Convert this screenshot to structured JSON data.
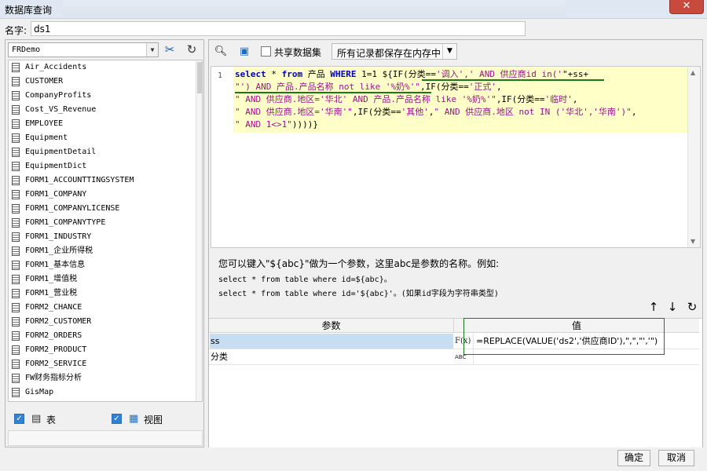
{
  "window": {
    "title": "数据库查询",
    "close_glyph": "✕"
  },
  "name_row": {
    "label": "名字:",
    "value": "ds1"
  },
  "left": {
    "datasource": "FRDemo",
    "tables": [
      "Air_Accidents",
      "CUSTOMER",
      "CompanyProfits",
      "Cost_VS_Revenue",
      "EMPLOYEE",
      "Equipment",
      "EquipmentDetail",
      "EquipmentDict",
      "FORM1_ACCOUNTTINGSYSTEM",
      "FORM1_COMPANY",
      "FORM1_COMPANYLICENSE",
      "FORM1_COMPANYTYPE",
      "FORM1_INDUSTRY",
      "FORM1_企业所得税",
      "FORM1_基本信息",
      "FORM1_增值税",
      "FORM1_营业税",
      "FORM2_CHANCE",
      "FORM2_CUSTOMER",
      "FORM2_ORDERS",
      "FORM2_PRODUCT",
      "FORM2_SERVICE",
      "FW财务指标分析",
      "GisMap"
    ],
    "option_table": "表",
    "option_view": "视图",
    "icons": {
      "connect": "tools-icon",
      "refresh": "refresh-icon"
    }
  },
  "right": {
    "share_label": "共享数据集",
    "mode_value": "所有记录都保存在内存中",
    "sql": {
      "line_number": "1",
      "line1": {
        "k1": "select",
        "p1": " * ",
        "k2": "from",
        "p2": " 产品 ",
        "k3": "WHERE",
        "p3": " 1=1 ${IF(分类==",
        "s1": "'调入','",
        "s2": " AND 供应商id in('",
        "s3": "\"+ss+"
      },
      "line2": {
        "s1": "\"') AND 产品.产品名称 not like '%奶%'\"",
        "p1": ",IF(分类==",
        "s2": "'正式'",
        "p2": ","
      },
      "line3": {
        "s1": "\" AND 供应商.地区='华北' AND 产品.产品名称 like '%奶%'\"",
        "p1": ",IF(分类==",
        "s2": "'临时'",
        "p2": ","
      },
      "line4": {
        "s1": "\" AND 供应商.地区='华南'\"",
        "p1": ",IF(分类==",
        "s2": "'其他'",
        "p2": ",",
        "s3": "\" AND 供应商.地区 not IN ('华北','华南')\"",
        "p3": ","
      },
      "line5": {
        "s1": "\" AND 1<>1\"",
        "p1": "))))}"
      }
    },
    "help": {
      "line1": "您可以键入\"${abc}\"做为一个参数，这里abc是参数的名称。例如:",
      "line2": "select * from table where id=${abc}。",
      "line3": "select * from table where id='${abc}'。(如果id字段为字符串类型)"
    },
    "param_table": {
      "headers": {
        "name": "参数",
        "value": "值"
      },
      "rows": [
        {
          "name": "ss",
          "type": "F(x)",
          "value": "=REPLACE(VALUE('ds2','供应商ID'),\",\",\"','\")"
        },
        {
          "name": "分类",
          "type": "ABC",
          "value": ""
        }
      ]
    }
  },
  "footer": {
    "ok": "确定",
    "cancel": "取消"
  }
}
